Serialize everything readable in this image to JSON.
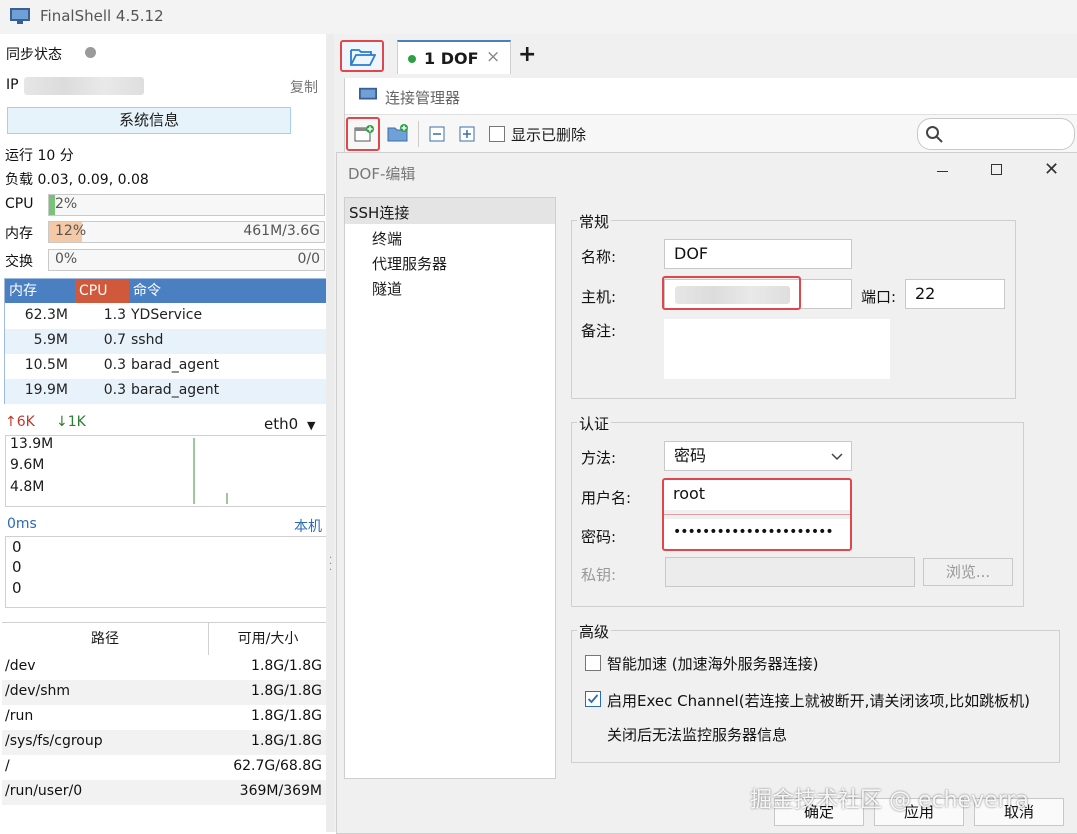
{
  "app": {
    "title": "FinalShell 4.5.12"
  },
  "left": {
    "sync_label": "同步状态",
    "ip_label": "IP",
    "copy_label": "复制",
    "sysinfo_button": "系统信息",
    "uptime": "运行 10 分",
    "load": "负载 0.03, 0.09, 0.08",
    "cpu": {
      "label": "CPU",
      "pct": "2%",
      "fraction": 0.02
    },
    "mem": {
      "label": "内存",
      "pct": "12%",
      "fraction": 0.12,
      "amount": "461M/3.6G"
    },
    "swap": {
      "label": "交换",
      "pct": "0%",
      "fraction": 0,
      "amount": "0/0"
    },
    "proc_headers": [
      "内存",
      "CPU",
      "命令"
    ],
    "processes": [
      {
        "mem": "62.3M",
        "cpu": "1.3",
        "cmd": "YDService"
      },
      {
        "mem": "5.9M",
        "cpu": "0.7",
        "cmd": "sshd"
      },
      {
        "mem": "10.5M",
        "cpu": "0.3",
        "cmd": "barad_agent"
      },
      {
        "mem": "19.9M",
        "cpu": "0.3",
        "cmd": "barad_agent"
      }
    ],
    "net": {
      "up": "6K",
      "down": "1K",
      "iface": "eth0",
      "scale": [
        "13.9M",
        "9.6M",
        "4.8M"
      ]
    },
    "latency": {
      "label": "0ms",
      "host": "本机",
      "values": [
        "0",
        "0",
        "0"
      ]
    },
    "fs_headers": [
      "路径",
      "可用/大小"
    ],
    "filesystems": [
      {
        "path": "/dev",
        "size": "1.8G/1.8G"
      },
      {
        "path": "/dev/shm",
        "size": "1.8G/1.8G"
      },
      {
        "path": "/run",
        "size": "1.8G/1.8G"
      },
      {
        "path": "/sys/fs/cgroup",
        "size": "1.8G/1.8G"
      },
      {
        "path": "/",
        "size": "62.7G/68.8G"
      },
      {
        "path": "/run/user/0",
        "size": "369M/369M"
      }
    ]
  },
  "tab": {
    "label": "1 DOF",
    "close": "×",
    "add": "+"
  },
  "conn_manager": {
    "title": "连接管理器",
    "show_deleted": "显示已删除"
  },
  "edit_dialog": {
    "title": "DOF-编辑",
    "tree": [
      "SSH连接",
      "终端",
      "代理服务器",
      "隧道"
    ],
    "general": {
      "title": "常规",
      "name_label": "名称:",
      "name_value": "DOF",
      "host_label": "主机:",
      "port_label": "端口:",
      "port_value": "22",
      "note_label": "备注:"
    },
    "auth": {
      "title": "认证",
      "method_label": "方法:",
      "method_value": "密码",
      "user_label": "用户名:",
      "user_value": "root",
      "pass_label": "密码:",
      "pass_value": "••••••••••••••••••••••",
      "key_label": "私钥:",
      "browse": "浏览..."
    },
    "advanced": {
      "title": "高级",
      "smart_accel": "智能加速 (加速海外服务器连接)",
      "exec_channel": "启用Exec Channel(若连接上就被断开,请关闭该项,比如跳板机)",
      "note": "关闭后无法监控服务器信息"
    },
    "buttons": {
      "ok": "确定",
      "apply": "应用",
      "cancel": "取消"
    }
  },
  "watermark": "掘金技术社区 @ echeverra",
  "colors": {
    "accent": "#4a7fc1",
    "highlight": "#e0474c",
    "cpu_header": "#d0593b",
    "mem_fill": "#f5c9a6"
  }
}
